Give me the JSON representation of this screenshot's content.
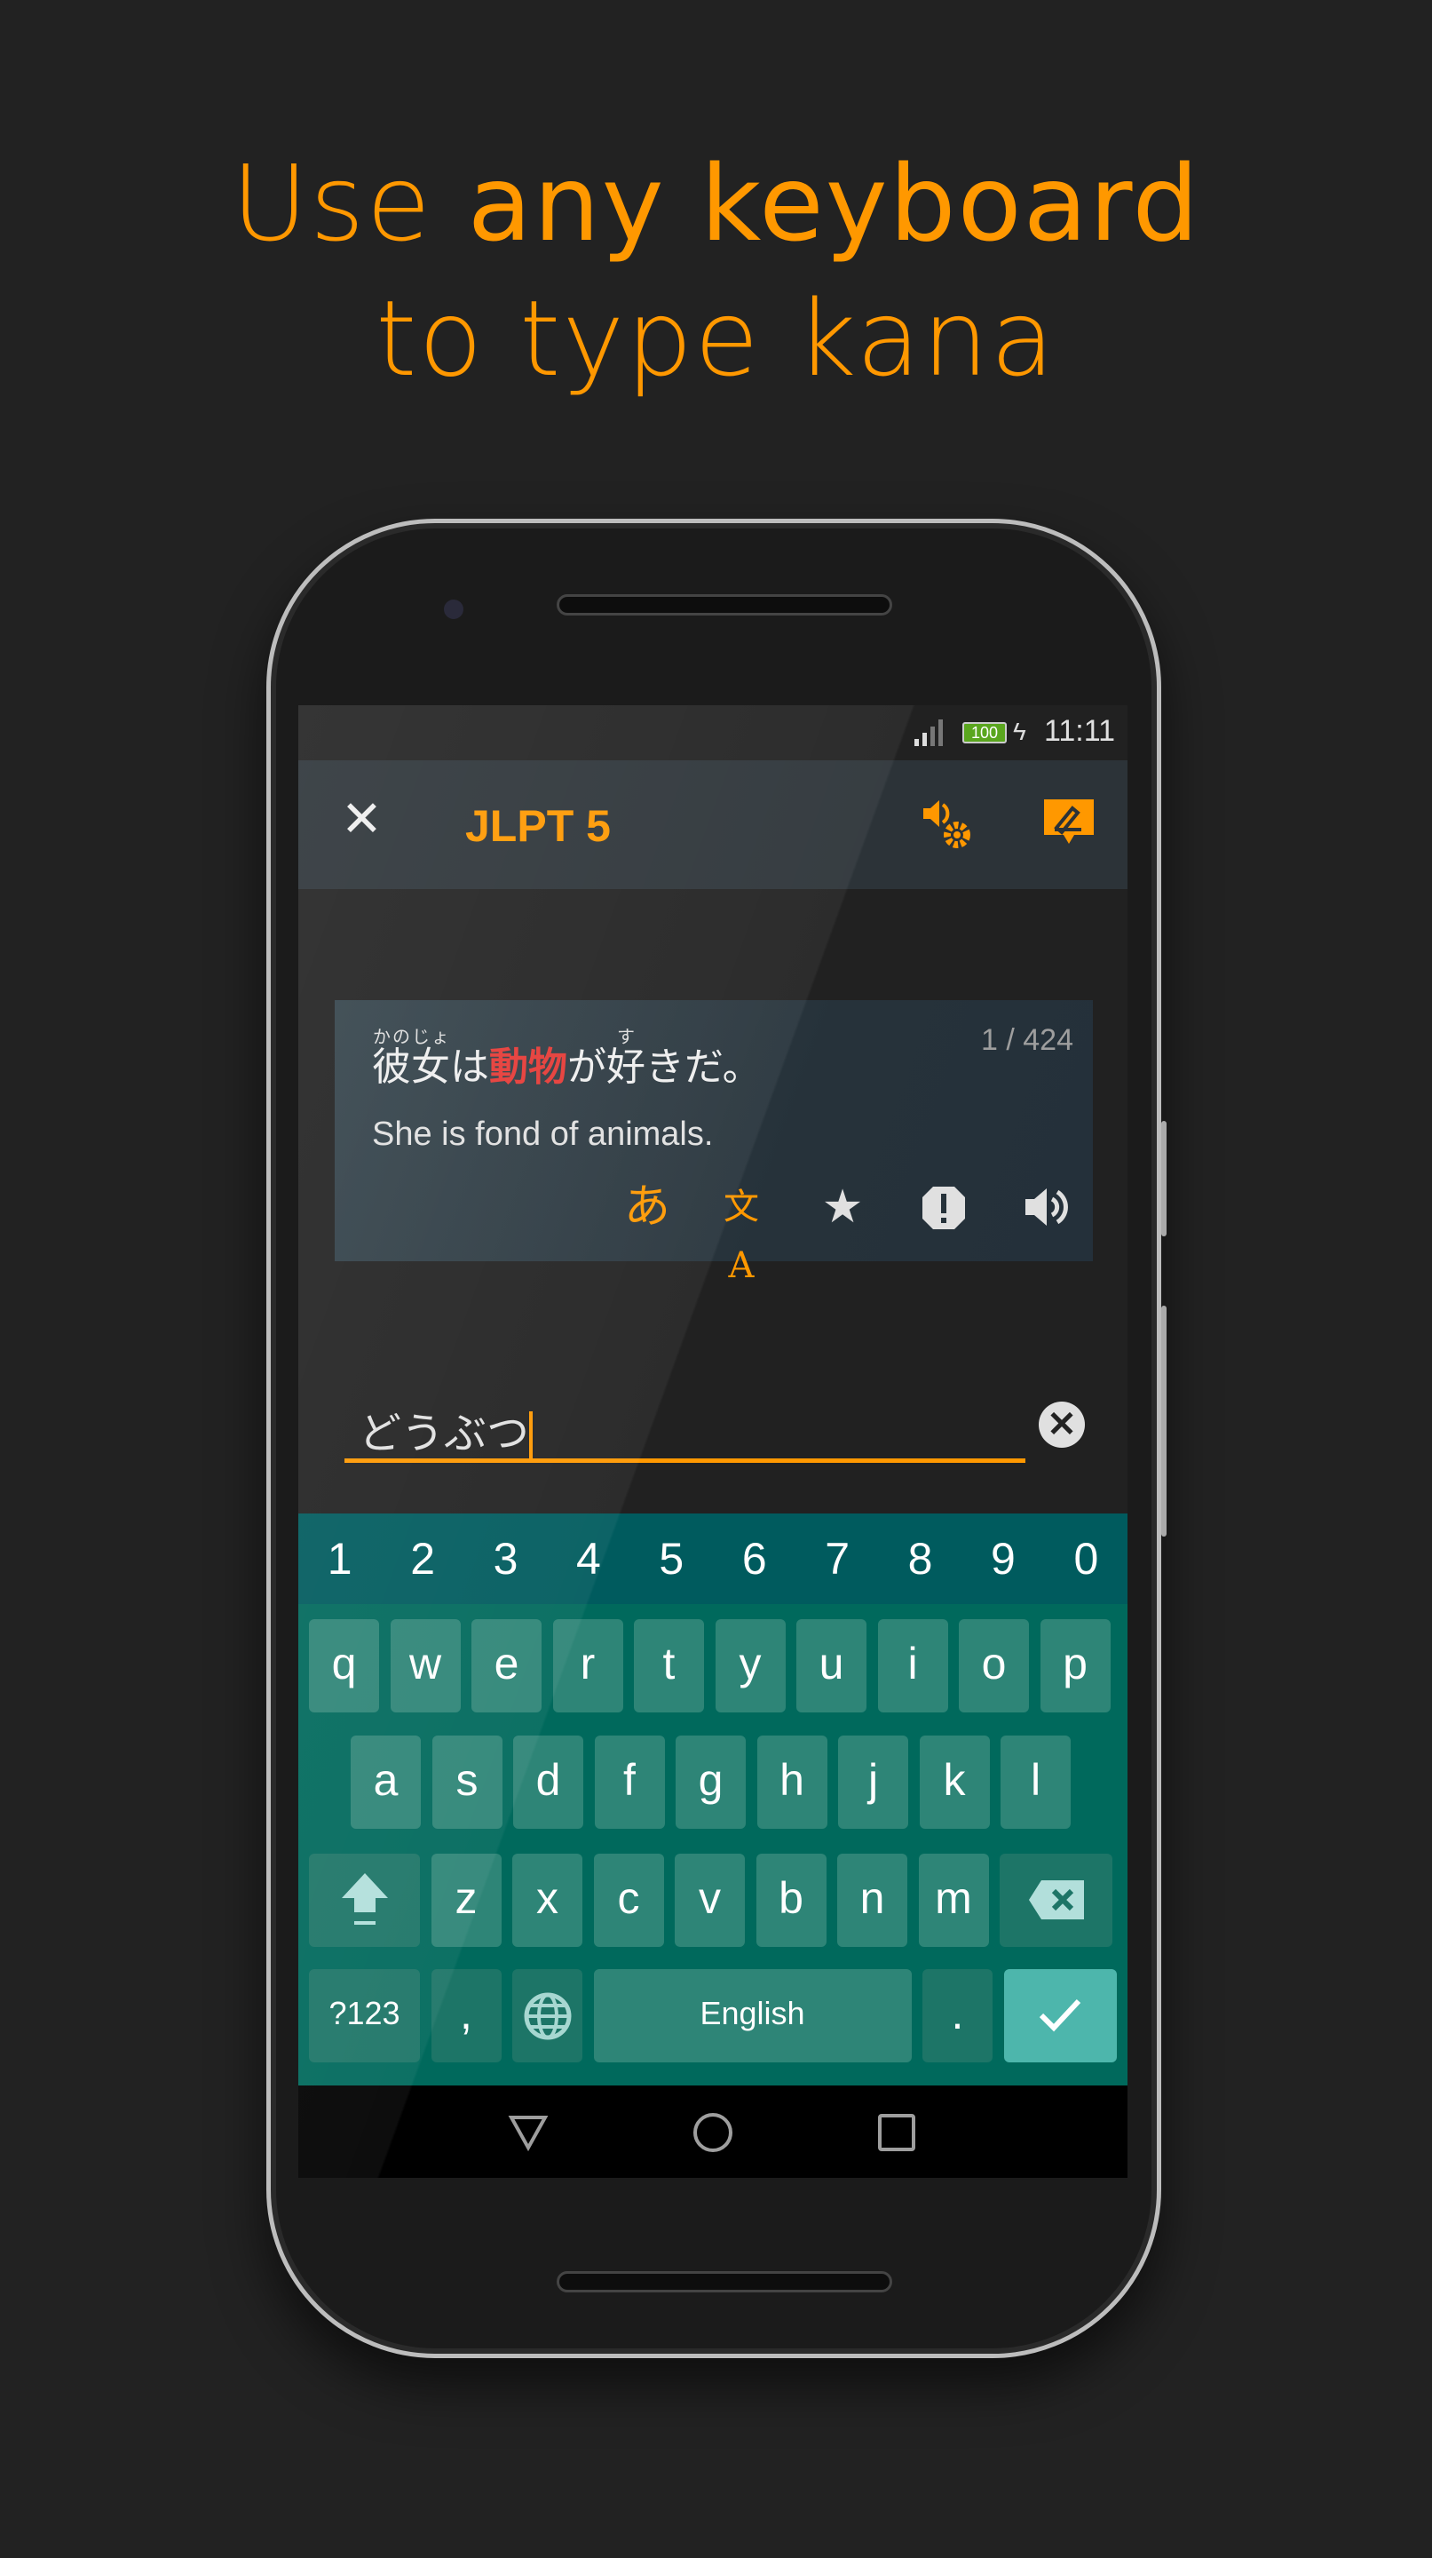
{
  "headline": {
    "line1_pre": "Use ",
    "line1_bold": "any keyboard",
    "line2": "to type kana"
  },
  "colors": {
    "accent": "#ff9800",
    "highlight": "#e53935",
    "keyboard": "#00695c",
    "enter_key": "#4db6ac"
  },
  "status_bar": {
    "battery": "100",
    "time": "11:11",
    "icons": [
      "signal-icon",
      "battery-icon",
      "charging-icon"
    ]
  },
  "toolbar": {
    "title": "JLPT 5",
    "icons": [
      "close-icon",
      "audio-settings-icon",
      "feedback-edit-icon"
    ]
  },
  "card": {
    "counter": "1 / 424",
    "sentence": [
      {
        "text": "彼女",
        "furigana": "かのじょ"
      },
      {
        "text": "は"
      },
      {
        "text": "動物",
        "highlight": true
      },
      {
        "text": "が"
      },
      {
        "text": "好",
        "furigana": "す"
      },
      {
        "text": "きだ。"
      }
    ],
    "translation": "She is fond of animals.",
    "actions": {
      "kana": "あ",
      "translate_label": "文A"
    },
    "action_icons": [
      "kana-icon",
      "translate-icon",
      "star-icon",
      "report-icon",
      "speaker-icon"
    ]
  },
  "answer_input": {
    "value": "どうぶつ"
  },
  "keyboard": {
    "numbers": [
      "1",
      "2",
      "3",
      "4",
      "5",
      "6",
      "7",
      "8",
      "9",
      "0"
    ],
    "row1": [
      "q",
      "w",
      "e",
      "r",
      "t",
      "y",
      "u",
      "i",
      "o",
      "p"
    ],
    "row2": [
      "a",
      "s",
      "d",
      "f",
      "g",
      "h",
      "j",
      "k",
      "l"
    ],
    "row3": [
      "z",
      "x",
      "c",
      "v",
      "b",
      "n",
      "m"
    ],
    "symbols_label": "?123",
    "comma": ",",
    "space_label": "English",
    "period": "."
  },
  "navigation": [
    "back-icon",
    "home-icon",
    "recents-icon"
  ]
}
